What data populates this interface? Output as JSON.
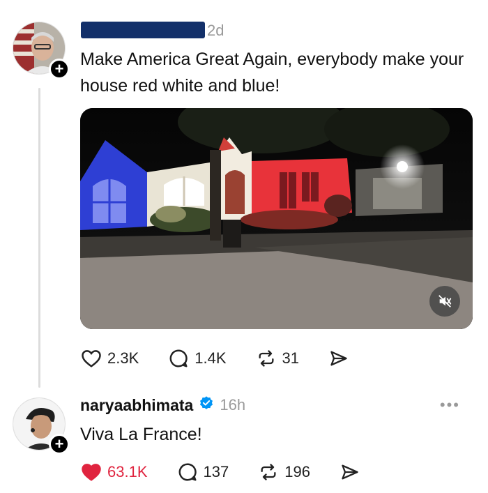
{
  "post": {
    "time": "2d",
    "text": "Make America Great Again, everybody make your house red white and blue!",
    "actions": {
      "likes": "2.3K",
      "comments": "1.4K",
      "reposts": "31"
    }
  },
  "reply": {
    "username": "naryaabhimata",
    "time": "16h",
    "text": "Viva La France!",
    "actions": {
      "likes": "63.1K",
      "comments": "137",
      "reposts": "196"
    }
  },
  "icons": {
    "follow": "+",
    "more": "•••"
  },
  "colors": {
    "like_active": "#e0243f",
    "verified": "#0095f6",
    "redaction": "#13306a"
  }
}
